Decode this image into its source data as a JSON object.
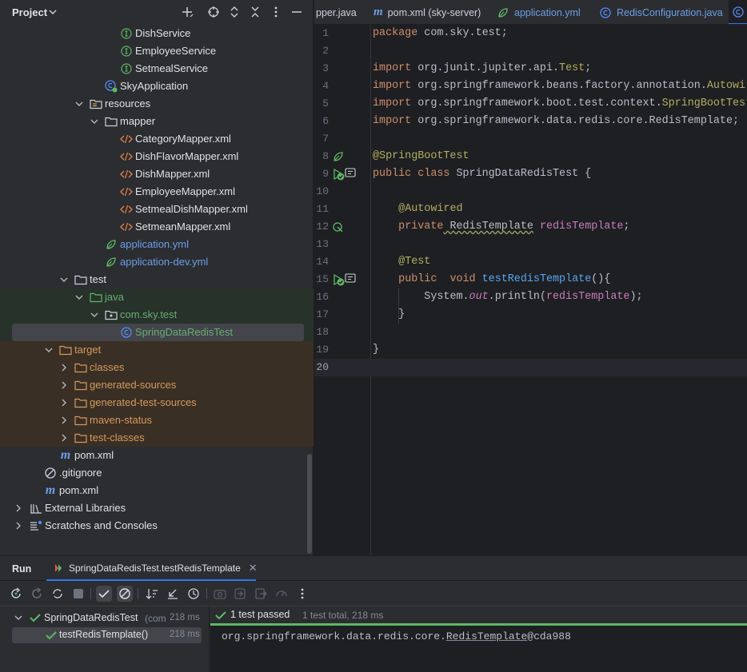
{
  "project": {
    "title": "Project",
    "tree": [
      {
        "label": "DishService",
        "icon": "interface-icon",
        "color": "#dfe1e5"
      },
      {
        "label": "EmployeeService",
        "icon": "interface-icon",
        "color": "#dfe1e5"
      },
      {
        "label": "SetmealService",
        "icon": "interface-icon",
        "color": "#dfe1e5"
      },
      {
        "label": "SkyApplication",
        "icon": "spring-class-icon",
        "color": "#dfe1e5"
      },
      {
        "label": "resources",
        "icon": "resources-folder-icon",
        "color": "#dfe1e5"
      },
      {
        "label": "mapper",
        "icon": "folder-icon",
        "color": "#dfe1e5"
      },
      {
        "label": "CategoryMapper.xml",
        "icon": "xml-icon",
        "color": "#dfe1e5"
      },
      {
        "label": "DishFlavorMapper.xml",
        "icon": "xml-icon",
        "color": "#dfe1e5"
      },
      {
        "label": "DishMapper.xml",
        "icon": "xml-icon",
        "color": "#dfe1e5"
      },
      {
        "label": "EmployeeMapper.xml",
        "icon": "xml-icon",
        "color": "#dfe1e5"
      },
      {
        "label": "SetmealDishMapper.xml",
        "icon": "xml-icon",
        "color": "#dfe1e5"
      },
      {
        "label": "SetmeanMapper.xml",
        "icon": "xml-icon",
        "color": "#dfe1e5"
      },
      {
        "label": "application.yml",
        "icon": "yaml-spring-icon",
        "color": "#6c9ee8"
      },
      {
        "label": "application-dev.yml",
        "icon": "yaml-spring-icon",
        "color": "#6c9ee8"
      },
      {
        "label": "test",
        "icon": "folder-icon",
        "color": "#dfe1e5"
      },
      {
        "label": "java",
        "icon": "test-folder-icon",
        "color": "#6aab73"
      },
      {
        "label": "com.sky.test",
        "icon": "package-icon",
        "color": "#6aab73"
      },
      {
        "label": "SpringDataRedisTest",
        "icon": "class-icon",
        "color": "#6aab73"
      },
      {
        "label": "target",
        "icon": "excluded-folder-icon",
        "color": "#d49a5c"
      },
      {
        "label": "classes",
        "icon": "excluded-folder-icon",
        "color": "#d49a5c"
      },
      {
        "label": "generated-sources",
        "icon": "excluded-folder-icon",
        "color": "#d49a5c"
      },
      {
        "label": "generated-test-sources",
        "icon": "excluded-folder-icon",
        "color": "#d49a5c"
      },
      {
        "label": "maven-status",
        "icon": "excluded-folder-icon",
        "color": "#d49a5c"
      },
      {
        "label": "test-classes",
        "icon": "excluded-folder-icon",
        "color": "#d49a5c"
      },
      {
        "label": "pom.xml",
        "icon": "maven-icon",
        "color": "#dfe1e5"
      },
      {
        "label": ".gitignore",
        "icon": "ignore-icon",
        "color": "#dfe1e5"
      },
      {
        "label": "pom.xml",
        "icon": "maven-icon",
        "color": "#dfe1e5"
      },
      {
        "label": "External Libraries",
        "icon": "library-icon",
        "color": "#dfe1e5"
      },
      {
        "label": "Scratches and Consoles",
        "icon": "scratches-icon",
        "color": "#dfe1e5"
      }
    ]
  },
  "tabs": [
    {
      "label": "pper.java",
      "icon": "",
      "color": "#ced0d6"
    },
    {
      "label": "pom.xml (sky-server)",
      "icon": "maven-icon",
      "color": "#ced0d6"
    },
    {
      "label": "application.yml",
      "icon": "yaml-spring-icon",
      "color": "#6c9ee8"
    },
    {
      "label": "RedisConfiguration.java",
      "icon": "class-icon",
      "color": "#6c9ee8"
    }
  ],
  "editor": {
    "line_numbers": [
      "1",
      "2",
      "3",
      "4",
      "5",
      "6",
      "7",
      "8",
      "9",
      "10",
      "11",
      "12",
      "13",
      "14",
      "15",
      "16",
      "17",
      "18",
      "19",
      "20"
    ],
    "lines": {
      "l1_kw": "package",
      "l1_rest": " com.sky.test;",
      "l3_kw": "import",
      "l3_a": " org.junit.jupiter.api.",
      "l3_b": "Test",
      "l3_c": ";",
      "l4_kw": "import",
      "l4_a": " org.springframework.beans.factory.annotation.",
      "l4_b": "Autowired",
      "l5_kw": "import",
      "l5_a": " org.springframework.boot.test.context.",
      "l5_b": "SpringBootTest",
      "l6_kw": "import",
      "l6_a": " org.springframework.data.redis.core.RedisTemplate;",
      "l8_ann": "@SpringBootTest",
      "l9_kw": "public class",
      "l9_rest": " SpringDataRedisTest {",
      "l11_ann": "@Autowired",
      "l12_kw": "private",
      "l12_type": " RedisTemplate",
      "l12_fld": " redisTemplate",
      "l12_end": ";",
      "l14_ann": "@Test",
      "l15_kw": "public  void",
      "l15_fn": " testRedisTemplate",
      "l15_end": "(){",
      "l16_a": "System.",
      "l16_out": "out",
      "l16_b": ".println(",
      "l16_fld": "redisTemplate",
      "l16_c": ");",
      "l17": "}",
      "l19": "}"
    }
  },
  "run": {
    "title": "Run",
    "config_tab": "SpringDataRedisTest.testRedisTemplate",
    "tree": {
      "suite": "SpringDataRedisTest",
      "suite_suffix": "(com",
      "suite_time": "218 ms",
      "test": "testRedisTemplate()",
      "test_time": "218 ms"
    },
    "status": "1 test passed",
    "summary": "1 test total, 218 ms",
    "output_a": "org.springframework.data.redis.core.",
    "output_b": "RedisTemplate",
    "output_c": "@cda988"
  },
  "colors": {
    "accent_green": "#5fb865",
    "yaml_blue": "#6c9ee8",
    "excluded_orange": "#d49a5c"
  }
}
